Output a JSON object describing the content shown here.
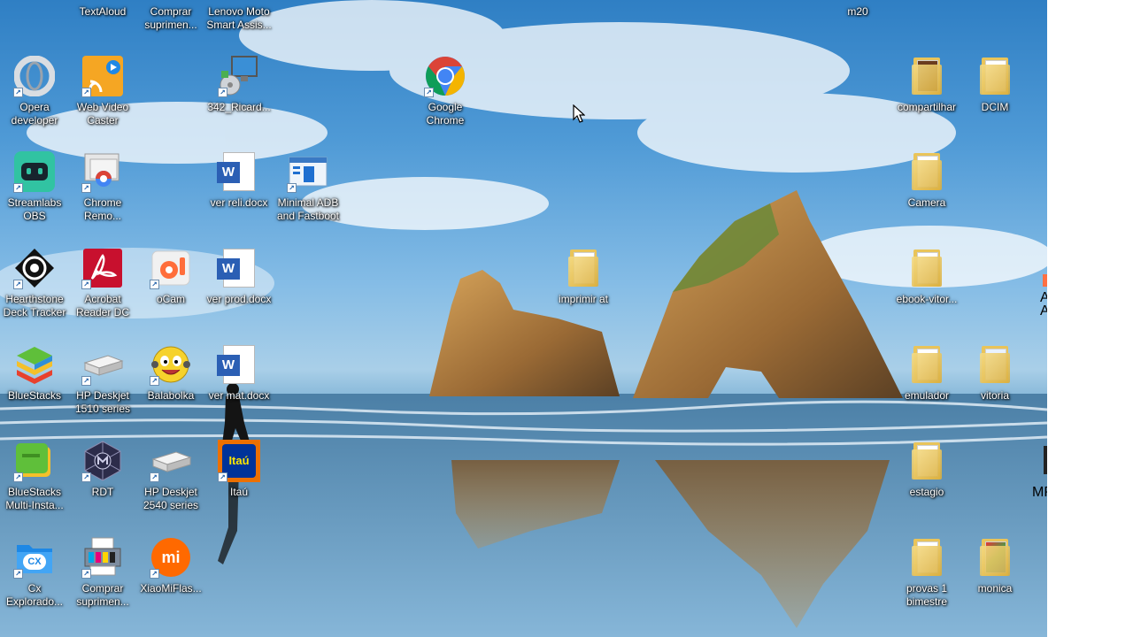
{
  "desktop": {
    "icons": [
      {
        "key": "textaloud",
        "label": "TextAloud"
      },
      {
        "key": "comprar-suprimentos-1",
        "label": "Comprar suprimen..."
      },
      {
        "key": "lenovo-moto",
        "label": "Lenovo Moto Smart Assis..."
      },
      {
        "key": "m20",
        "label": "m20"
      },
      {
        "key": "opera",
        "label": "Opera developer"
      },
      {
        "key": "web-video-caster",
        "label": "Web Video Caster"
      },
      {
        "key": "ricardo",
        "label": "342_Ricard..."
      },
      {
        "key": "chrome",
        "label": "Google Chrome"
      },
      {
        "key": "compartilhar",
        "label": "compartilhar"
      },
      {
        "key": "dcim",
        "label": "DCIM"
      },
      {
        "key": "streamlabs",
        "label": "Streamlabs OBS"
      },
      {
        "key": "chrome-remote",
        "label": "Chrome Remo..."
      },
      {
        "key": "ver-reli",
        "label": "ver reli.docx"
      },
      {
        "key": "minimal-adb",
        "label": "Minimal ADB and Fastboot"
      },
      {
        "key": "camera",
        "label": "Camera"
      },
      {
        "key": "hearthstone",
        "label": "Hearthstone Deck Tracker"
      },
      {
        "key": "acrobat",
        "label": "Acrobat Reader DC"
      },
      {
        "key": "ocam",
        "label": "oCam"
      },
      {
        "key": "ver-prod",
        "label": "ver prod.docx"
      },
      {
        "key": "imprimir",
        "label": "imprimir at"
      },
      {
        "key": "ebook",
        "label": "ebook-vitor..."
      },
      {
        "key": "bluestacks",
        "label": "BlueStacks"
      },
      {
        "key": "hp-1510",
        "label": "HP Deskjet 1510 series"
      },
      {
        "key": "balabolka",
        "label": "Balabolka"
      },
      {
        "key": "ver-mat",
        "label": "ver mat.docx"
      },
      {
        "key": "emulador",
        "label": "emulador"
      },
      {
        "key": "vitoria",
        "label": "vitoria"
      },
      {
        "key": "bluestacks-multi",
        "label": "BlueStacks Multi-Insta..."
      },
      {
        "key": "rdt",
        "label": "RDT"
      },
      {
        "key": "hp-2540",
        "label": "HP Deskjet 2540 series"
      },
      {
        "key": "itau",
        "label": "Itaú"
      },
      {
        "key": "estagio",
        "label": "estagio"
      },
      {
        "key": "cx",
        "label": "Cx Explorado..."
      },
      {
        "key": "comprar-suprimentos-2",
        "label": "Comprar suprimen..."
      },
      {
        "key": "xiaomiflash",
        "label": "XiaoMiFlas..."
      },
      {
        "key": "provas",
        "label": "provas 1 bimestre"
      },
      {
        "key": "monica",
        "label": "monica"
      }
    ],
    "partial_labels": {
      "edge_a": "A",
      "edge_b": "A",
      "edge_mp": "MP"
    },
    "icon_text": {
      "cx": "CX",
      "itau": "Itaú",
      "word": "W",
      "mi": "mi"
    },
    "colors": {
      "chrome_red": "#db4437",
      "chrome_yellow": "#f4b400",
      "chrome_green": "#0f9d58",
      "chrome_blue": "#4285f4",
      "acrobat": "#c8102e",
      "itau": "#ec7000",
      "word": "#2b5fb4",
      "folder": "#e9c45a"
    }
  }
}
